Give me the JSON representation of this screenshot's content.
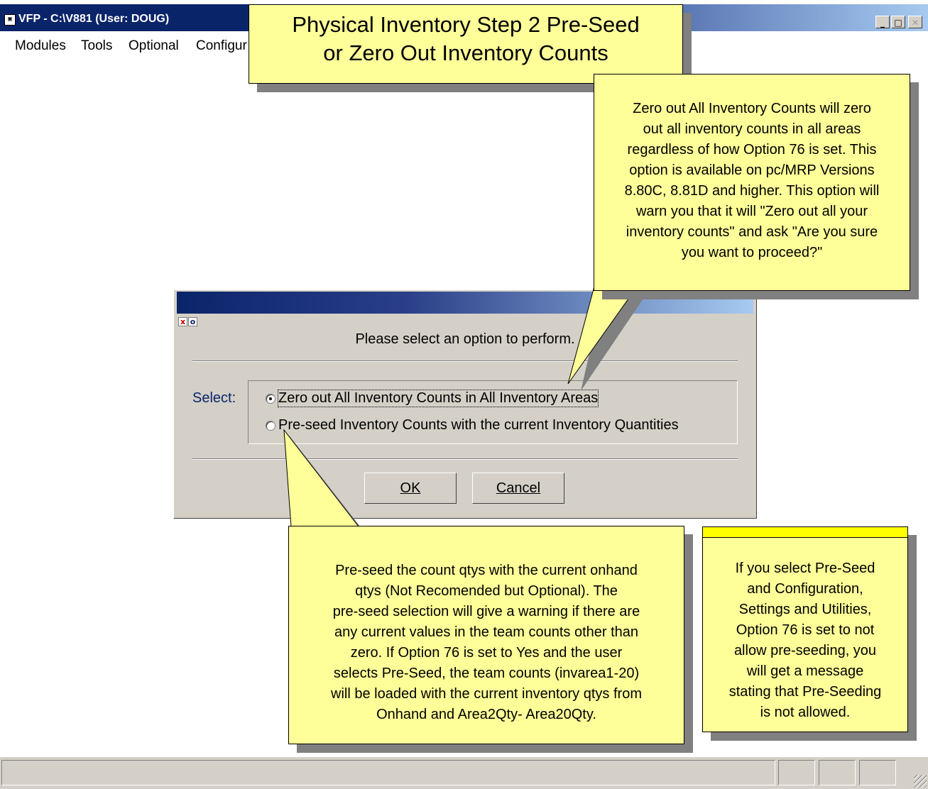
{
  "window": {
    "title": "VFP - C:\\V881  (User: DOUG)",
    "icon_glyph": "▣",
    "controls": [
      "_",
      "□",
      "✕"
    ]
  },
  "menu": {
    "items": [
      "Modules",
      "Tools",
      "Optional",
      "Configur"
    ]
  },
  "callouts": {
    "title_lines": [
      "Physical Inventory Step 2 Pre-Seed",
      "or Zero Out Inventory Counts"
    ],
    "zero_out_lines": [
      "Zero out All Inventory Counts will zero",
      "out all inventory counts in all areas",
      "regardless of how Option 76 is set.  This",
      "option is available on pc/MRP Versions",
      "8.80C, 8.81D and higher.  This option will",
      "warn you that it will \"Zero out all your",
      "inventory counts\" and ask \"Are you sure",
      "you want to proceed?\""
    ],
    "preseed_lines": [
      "Pre-seed the count qtys with the current onhand",
      "qtys (Not Recomended but Optional).   The",
      "pre-seed selection will give a warning if there are",
      "any current values in the team counts other than",
      "zero.  If Option 76 is set to Yes and  the user",
      "selects Pre-Seed, the team counts (invarea1-20)",
      "will be loaded with the current inventory qtys from",
      "Onhand and Area2Qty- Area20Qty."
    ],
    "option76_lines": [
      "If you select Pre-Seed",
      "and Configuration,",
      "Settings and Utilities,",
      "Option 76 is set to not",
      "allow pre-seeding, you",
      "will get a message",
      "stating that Pre-Seeding",
      "is not allowed."
    ]
  },
  "dialog": {
    "close_glyph": "x",
    "restore_glyph": "o",
    "prompt": "Please select an option to perform.",
    "select_label": "Select:",
    "options": [
      {
        "label": "Zero out All Inventory Counts in All Inventory Areas",
        "checked": true
      },
      {
        "label": "Pre-seed Inventory Counts with the current Inventory Quantities",
        "checked": false
      }
    ],
    "ok_label": "OK",
    "cancel_label": "Cancel"
  },
  "colors": {
    "callout_fill": "#ffff99",
    "callout_accent": "#ffff00",
    "titlebar": "#0a246a",
    "dialog_face": "#d4d0c8",
    "select_label": "#0a246a"
  }
}
